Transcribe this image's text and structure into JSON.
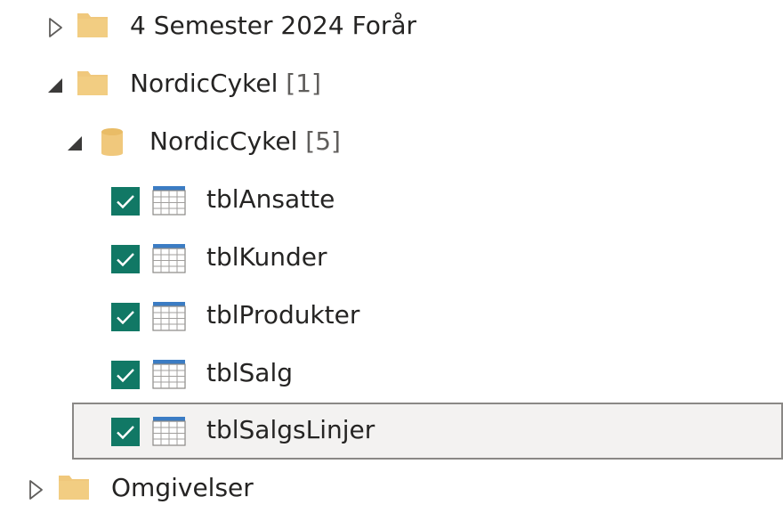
{
  "colors": {
    "folder": "#f0c87c",
    "checkbox": "#117865",
    "table_header": "#3b7cc4",
    "selected_border": "#8a8886"
  },
  "navigator": {
    "items": [
      {
        "label": "4 Semester 2024 Forår",
        "type": "folder",
        "expanded": false,
        "icon": "folder-icon"
      },
      {
        "label": "NordicCykel",
        "count": "[1]",
        "type": "folder",
        "expanded": true,
        "icon": "folder-icon"
      },
      {
        "label": "NordicCykel",
        "count": "[5]",
        "type": "database",
        "expanded": true,
        "icon": "database-icon"
      },
      {
        "label": "tblAnsatte",
        "type": "table",
        "checked": true,
        "icon": "table-icon"
      },
      {
        "label": "tblKunder",
        "type": "table",
        "checked": true,
        "icon": "table-icon"
      },
      {
        "label": "tblProdukter",
        "type": "table",
        "checked": true,
        "icon": "table-icon"
      },
      {
        "label": "tblSalg",
        "type": "table",
        "checked": true,
        "icon": "table-icon"
      },
      {
        "label": "tblSalgsLinjer",
        "type": "table",
        "checked": true,
        "selected": true,
        "icon": "table-icon"
      },
      {
        "label": "Omgivelser",
        "type": "folder",
        "expanded": false,
        "icon": "folder-icon"
      }
    ]
  }
}
